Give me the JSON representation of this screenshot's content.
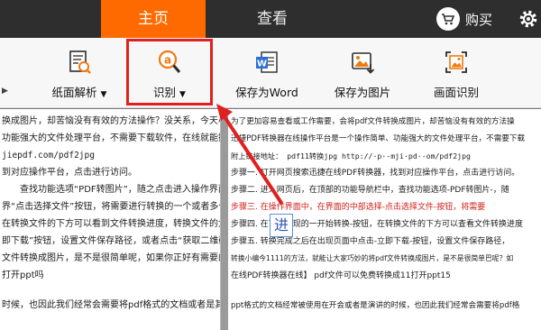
{
  "topbar": {
    "tabs": [
      {
        "label": "主页"
      },
      {
        "label": "查看"
      }
    ],
    "buy_label": "购买"
  },
  "toolbar": {
    "items": [
      {
        "label": "纸面解析",
        "icon": "document-analysis-icon",
        "dropdown": true
      },
      {
        "label": "识别",
        "icon": "recognize-icon",
        "dropdown": true
      },
      {
        "label": "保存为Word",
        "icon": "word-icon",
        "dropdown": false
      },
      {
        "label": "保存为图片",
        "icon": "image-save-icon",
        "dropdown": false
      },
      {
        "label": "画面识别",
        "icon": "image-recognize-icon",
        "dropdown": false
      }
    ],
    "caret": "▼"
  },
  "left_doc": {
    "lines": [
      "换成图片，却苦恼没有有效的方法操作？没关系，今天小",
      "功能强大的文件处理平台，不需要下载软件，在线就能操",
      "jiepdf.com/pdf2jpg",
      "到对应操作平台，点击进行访问。",
      "查找功能选项“PDF转图片”，随之点击进入操作界面。",
      "界“点击选择文件”按钮，将需要进行转换的一个或者多个",
      "在转换文件的下方可以看到文件转换进度，转换文件的大小",
      "即下载”按钮，设置文件保存路径，或者点击“获取二维码",
      "文件转换成图片，是不是很简单呢，如果你正好有需要的",
      "打开ppt吗",
      "时候，也因此我们经常会需要将pdf格式的文档或者是其他"
    ]
  },
  "right_doc": {
    "lines": [
      "为了更加容易查看或工作需要，会将pdf文件转换成图片，却苦恼没有有效的方法操",
      "迅捷PDF转换器在线操作平台是一个操作简单、功能强大的文件处理平台，不需要下载",
      "附上链接地址： pdf11转换jpg http://·p·-mji·pd·-om/pdf2jpg",
      "步骤一. 打开网页搜索迅捷在线PDF转换器，找到对应操作平台，点击进行访问。",
      "步骤二. 进入网页后，在顶部的功能导航栏中，查找功能选项-PDF转图片-，随",
      "步骤三. 在操作界面中，在界面的中部选择-点击选择文件-按钮，将需要",
      "步骤四. 在下方出现的一开始转换-按钮，在转换文件的下方可以查看文件转换进度",
      "步骤五. 转换完成之后在出现页面中点击-立即下载-按钮，设置文件保存路径，",
      "转换小编今1111的方法，就能让大家巧妙的将pdf文件转换成图片，是不是很简单巴呢？如",
      "在线PDF转换器在线】 pdf文件可以免费转换成11打开ppt15",
      "ppt格式的文档经常被使用在开会或者是演讲的时候，也因此我们经常会需要将pdf格"
    ]
  },
  "popup_char": "进"
}
